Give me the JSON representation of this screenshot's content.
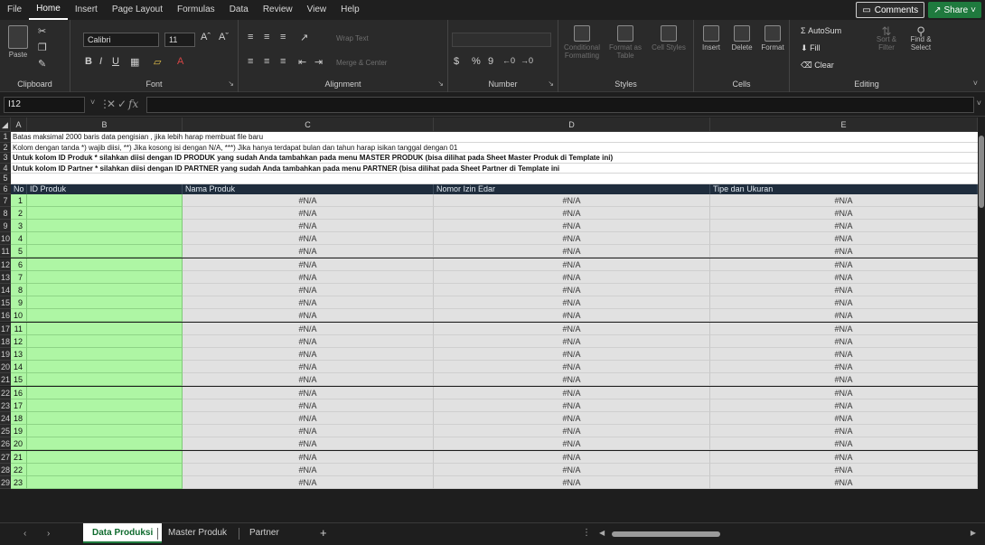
{
  "menubar": {
    "items": [
      "File",
      "Home",
      "Insert",
      "Page Layout",
      "Formulas",
      "Data",
      "Review",
      "View",
      "Help"
    ],
    "active_index": 1,
    "comments_label": "Comments",
    "share_label": "Share"
  },
  "ribbon": {
    "clipboard": {
      "label": "Clipboard",
      "paste": "Paste"
    },
    "font": {
      "label": "Font",
      "font_name": "Calibri",
      "font_size": "11"
    },
    "alignment": {
      "label": "Alignment",
      "wrap": "Wrap Text",
      "merge": "Merge & Center"
    },
    "number": {
      "label": "Number",
      "format": ""
    },
    "styles": {
      "label": "Styles",
      "conditional": "Conditional Formatting",
      "format_table": "Format as Table",
      "cell_styles": "Cell Styles"
    },
    "cells": {
      "label": "Cells",
      "insert": "Insert",
      "delete": "Delete",
      "format": "Format"
    },
    "editing": {
      "label": "Editing",
      "autosum": "AutoSum",
      "fill": "Fill",
      "clear": "Clear",
      "sort": "Sort & Filter",
      "find": "Find & Select"
    }
  },
  "formula_bar": {
    "name_box": "I12",
    "fx": "fx",
    "value": ""
  },
  "columns": [
    "A",
    "B",
    "C",
    "D",
    "E"
  ],
  "notes": [
    "Batas maksimal 2000 baris data pengisian , jika lebih harap membuat file baru",
    "Kolom dengan tanda *) wajib diisi, **) Jika kosong isi dengan N/A, ***) Jika hanya terdapat bulan dan tahun harap isikan tanggal dengan 01",
    "Untuk kolom ID Produk * silahkan diisi dengan ID PRODUK yang sudah Anda tambahkan pada menu MASTER PRODUK (bisa dilihat pada Sheet Master Produk di Template ini)",
    "Untuk kolom ID Partner * silahkan diisi dengan ID PARTNER yang sudah Anda tambahkan pada menu PARTNER (bisa dilihat pada Sheet Partner di Template ini"
  ],
  "table_headers": [
    "No",
    "ID Produk",
    "Nama Produk",
    "Nomor Izin Edar",
    "Tipe dan Ukuran"
  ],
  "rows": [
    {
      "no": "1",
      "na": "#N/A"
    },
    {
      "no": "2",
      "na": "#N/A"
    },
    {
      "no": "3",
      "na": "#N/A"
    },
    {
      "no": "4",
      "na": "#N/A"
    },
    {
      "no": "5",
      "na": "#N/A"
    },
    {
      "no": "6",
      "na": "#N/A"
    },
    {
      "no": "7",
      "na": "#N/A"
    },
    {
      "no": "8",
      "na": "#N/A"
    },
    {
      "no": "9",
      "na": "#N/A"
    },
    {
      "no": "10",
      "na": "#N/A"
    },
    {
      "no": "11",
      "na": "#N/A"
    },
    {
      "no": "12",
      "na": "#N/A"
    },
    {
      "no": "13",
      "na": "#N/A"
    },
    {
      "no": "14",
      "na": "#N/A"
    },
    {
      "no": "15",
      "na": "#N/A"
    },
    {
      "no": "16",
      "na": "#N/A"
    },
    {
      "no": "17",
      "na": "#N/A"
    },
    {
      "no": "18",
      "na": "#N/A"
    },
    {
      "no": "19",
      "na": "#N/A"
    },
    {
      "no": "20",
      "na": "#N/A"
    },
    {
      "no": "21",
      "na": "#N/A"
    },
    {
      "no": "22",
      "na": "#N/A"
    },
    {
      "no": "23",
      "na": "#N/A"
    }
  ],
  "row_numbers": [
    "1",
    "2",
    "3",
    "4",
    "5",
    "6",
    "7",
    "8",
    "9",
    "10",
    "11",
    "12",
    "13",
    "14",
    "15",
    "16",
    "17",
    "18",
    "19",
    "20",
    "21",
    "22",
    "23",
    "24",
    "25",
    "26",
    "27",
    "28",
    "29"
  ],
  "sheets": [
    "Data Produksi",
    "Master Produk",
    "Partner"
  ],
  "active_sheet": 0,
  "add_sheet": "+",
  "colors": {
    "green_cell": "#aef6a4",
    "gray_cell": "#e1e1e1",
    "header_bg": "#1f2d3d",
    "accent": "#1f7a3e"
  }
}
